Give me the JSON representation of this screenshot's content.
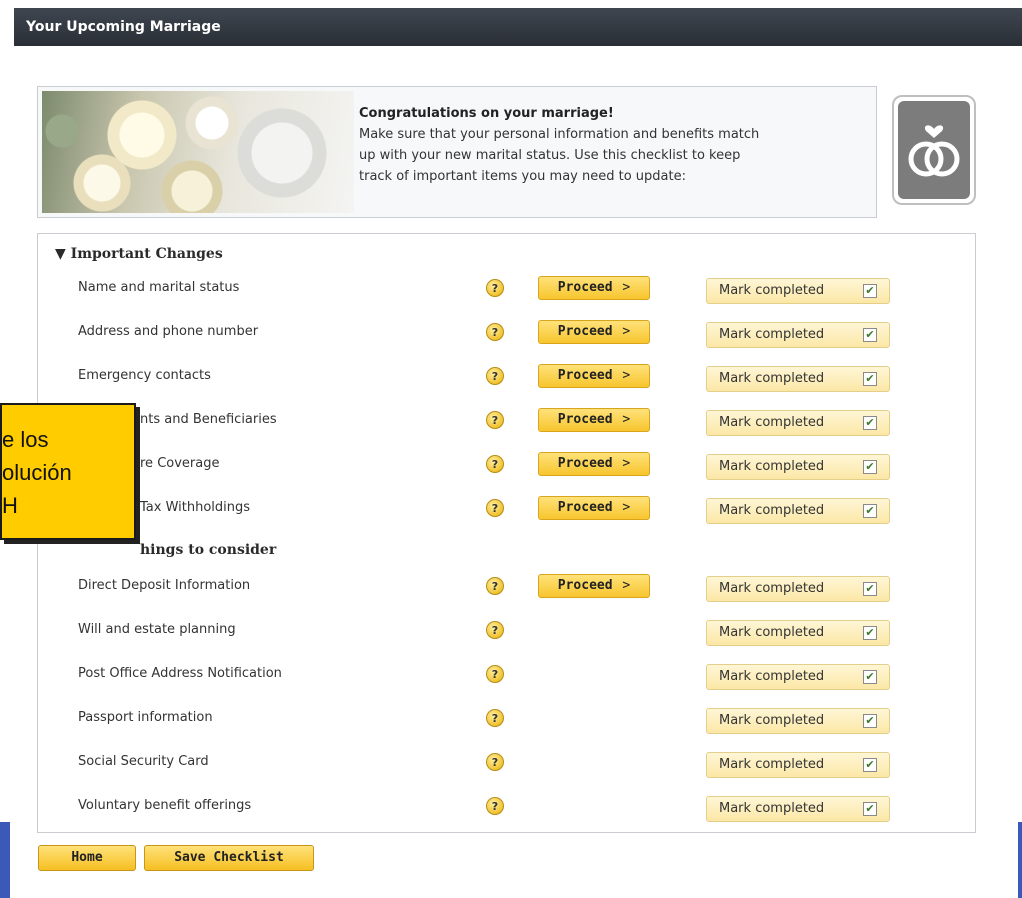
{
  "title": "Your Upcoming Marriage",
  "intro": {
    "heading": "Congratulations on your marriage!",
    "line1": "Make sure that your personal information and benefits match",
    "line2": "up with your new marital status. Use this checklist to keep",
    "line3": "track of important items you may need to update:"
  },
  "sections": {
    "important": {
      "label": "▼ Important Changes"
    },
    "other": {
      "label": "hings to consider"
    }
  },
  "help_glyph": "?",
  "proceed_label": "Proceed",
  "proceed_arrow": ">",
  "mark_label": "Mark completed",
  "mark_check": "✔",
  "rows": [
    {
      "label": "Name and marital status"
    },
    {
      "label": "Address and phone number"
    },
    {
      "label": "Emergency contacts"
    },
    {
      "label": "nts and Beneficiaries"
    },
    {
      "label": "re Coverage"
    },
    {
      "label": "Tax Withholdings"
    },
    {
      "label": "Direct Deposit Information"
    },
    {
      "label": "Will and estate planning"
    },
    {
      "label": "Post Office Address Notification"
    },
    {
      "label": "Passport information"
    },
    {
      "label": "Social Security Card"
    },
    {
      "label": "Voluntary benefit offerings"
    }
  ],
  "note": {
    "line1": "e los",
    "line2": "olución",
    "line3": "H"
  },
  "buttons": {
    "home": "Home",
    "save": "Save Checklist"
  },
  "colors": {
    "title_bar": "#2f353d",
    "button_yellow": "#f7c52e",
    "mark_yellow": "#fbe7a6",
    "note_yellow": "#ffcc00",
    "accent_blue": "#3a59b8"
  }
}
